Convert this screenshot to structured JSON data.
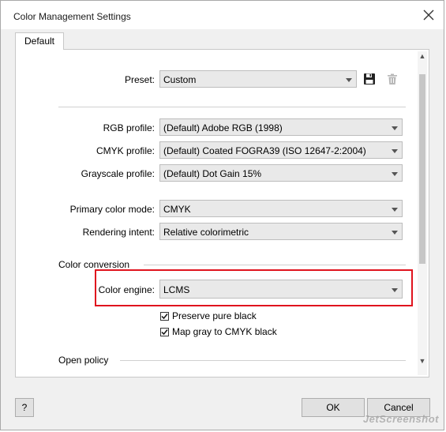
{
  "window": {
    "title": "Color Management Settings"
  },
  "tabs": [
    {
      "label": "Default"
    }
  ],
  "preset": {
    "label": "Preset:",
    "value": "Custom"
  },
  "profiles": {
    "rgb": {
      "label": "RGB profile:",
      "value": "(Default) Adobe RGB (1998)"
    },
    "cmyk": {
      "label": "CMYK profile:",
      "value": "(Default) Coated FOGRA39 (ISO 12647-2:2004)"
    },
    "grayscale": {
      "label": "Grayscale profile:",
      "value": "(Default) Dot Gain 15%"
    }
  },
  "modes": {
    "primary": {
      "label": "Primary color mode:",
      "value": "CMYK"
    },
    "intent": {
      "label": "Rendering intent:",
      "value": "Relative colorimetric"
    }
  },
  "conversion": {
    "heading": "Color conversion",
    "engine": {
      "label": "Color engine:",
      "value": "LCMS"
    },
    "preserve_black": {
      "label": "Preserve pure black",
      "checked": true
    },
    "map_gray": {
      "label": "Map gray to CMYK black",
      "checked": true
    }
  },
  "open_policy": {
    "heading": "Open policy"
  },
  "buttons": {
    "help": "?",
    "ok": "OK",
    "cancel": "Cancel"
  },
  "watermark": "JetScreenshot",
  "icons": {
    "save": "floppy-disk-icon",
    "delete": "trash-icon",
    "close": "close-icon",
    "check": "checkmark-icon"
  },
  "colors": {
    "highlight": "#e0141e",
    "panel": "#ffffff",
    "frame": "#f0f0f0"
  }
}
